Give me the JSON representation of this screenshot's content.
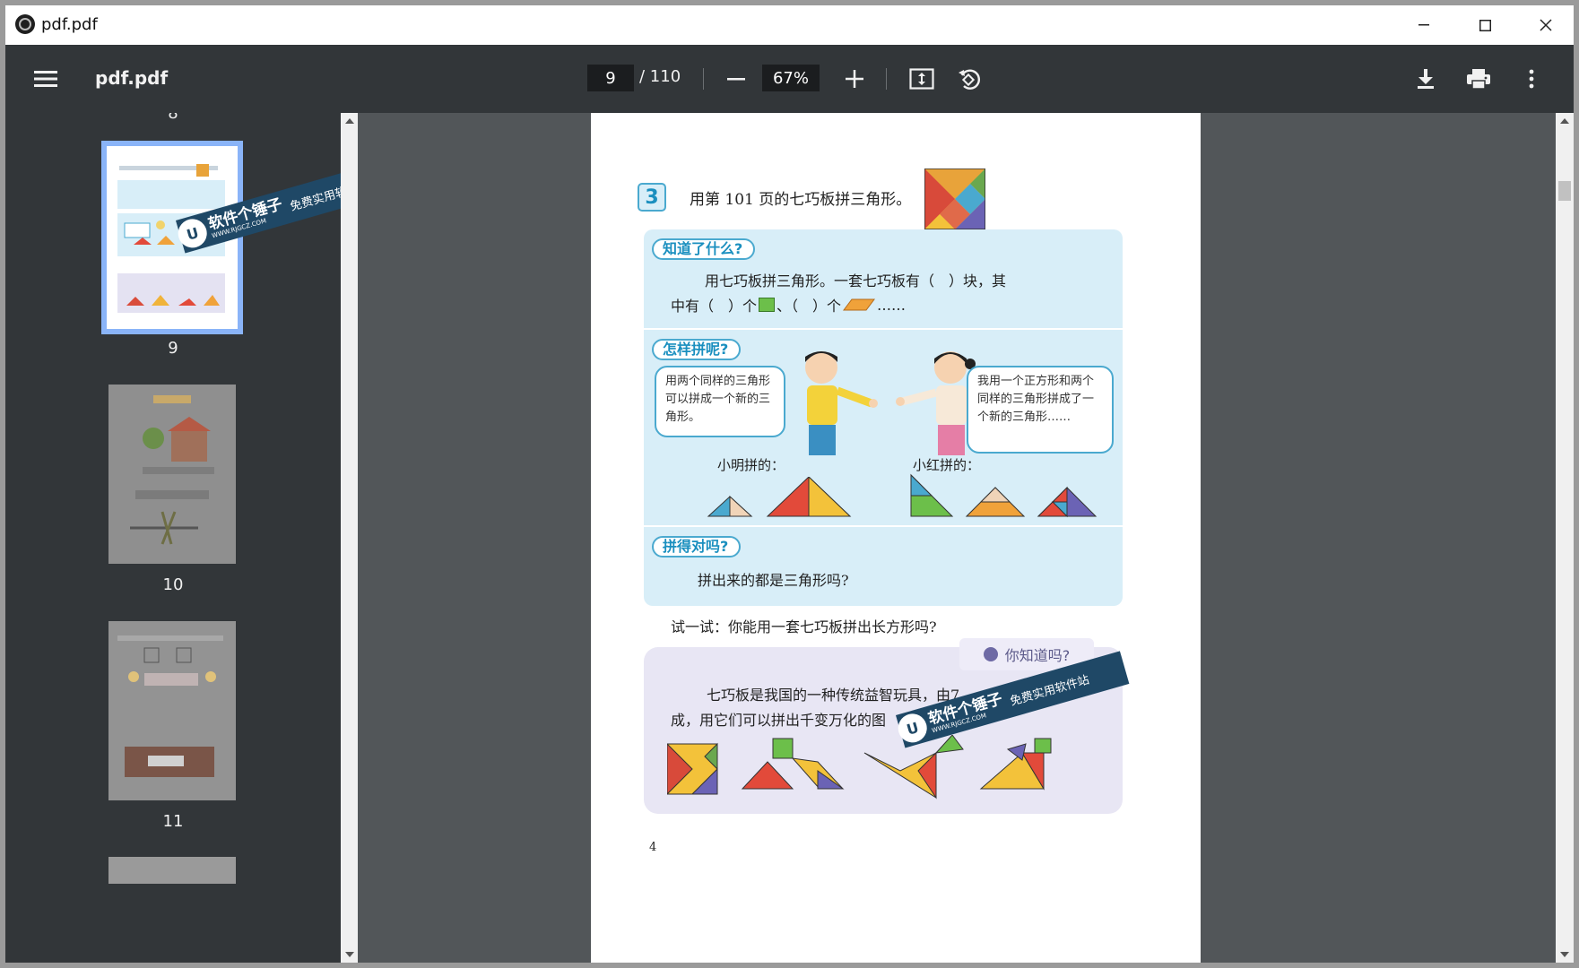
{
  "window": {
    "title": "pdf.pdf"
  },
  "toolbar": {
    "doc_title": "pdf.pdf",
    "page_current": "9",
    "page_total": "/ 110",
    "zoom": "67%"
  },
  "sidebar": {
    "thumbnails": [
      {
        "label": "8"
      },
      {
        "label": "9",
        "selected": true
      },
      {
        "label": "10"
      },
      {
        "label": "11"
      }
    ]
  },
  "watermark": {
    "brand": "软件个锤子",
    "url": "WWW.RJGCZ.COM",
    "slogan": "免费实用软件站"
  },
  "page": {
    "problem_number": "3",
    "problem_text": "用第 101 页的七巧板拼三角形。",
    "section1": {
      "tag": "知道了什么?",
      "line1": "用七巧板拼三角形。一套七巧板有（　）块，其",
      "line2_a": "中有（　）个",
      "line2_b": "、（　）个",
      "line2_c": "……"
    },
    "section2": {
      "tag": "怎样拼呢?",
      "bubble_left": "用两个同样的三角形可以拼成一个新的三角形。",
      "bubble_right": "我用一个正方形和两个同样的三角形拼成了一个新的三角形……",
      "label_left": "小明拼的：",
      "label_right": "小红拼的："
    },
    "section3": {
      "tag": "拼得对吗?",
      "text": "拼出来的都是三角形吗?"
    },
    "try_text": "试一试：你能用一套七巧板拼出长方形吗?",
    "didyouknow": {
      "tag": "你知道吗?",
      "line1": "七巧板是我国的一种传统益智玩具，由7",
      "line2": "成，用它们可以拼出千变万化的图"
    },
    "page_number": "4"
  },
  "colors": {
    "toolbar_bg": "#323639",
    "viewer_bg": "#525659",
    "panel_bg": "#d8eef8",
    "accent_blue": "#4aa9cf",
    "watermark_bg": "#1f4866"
  }
}
